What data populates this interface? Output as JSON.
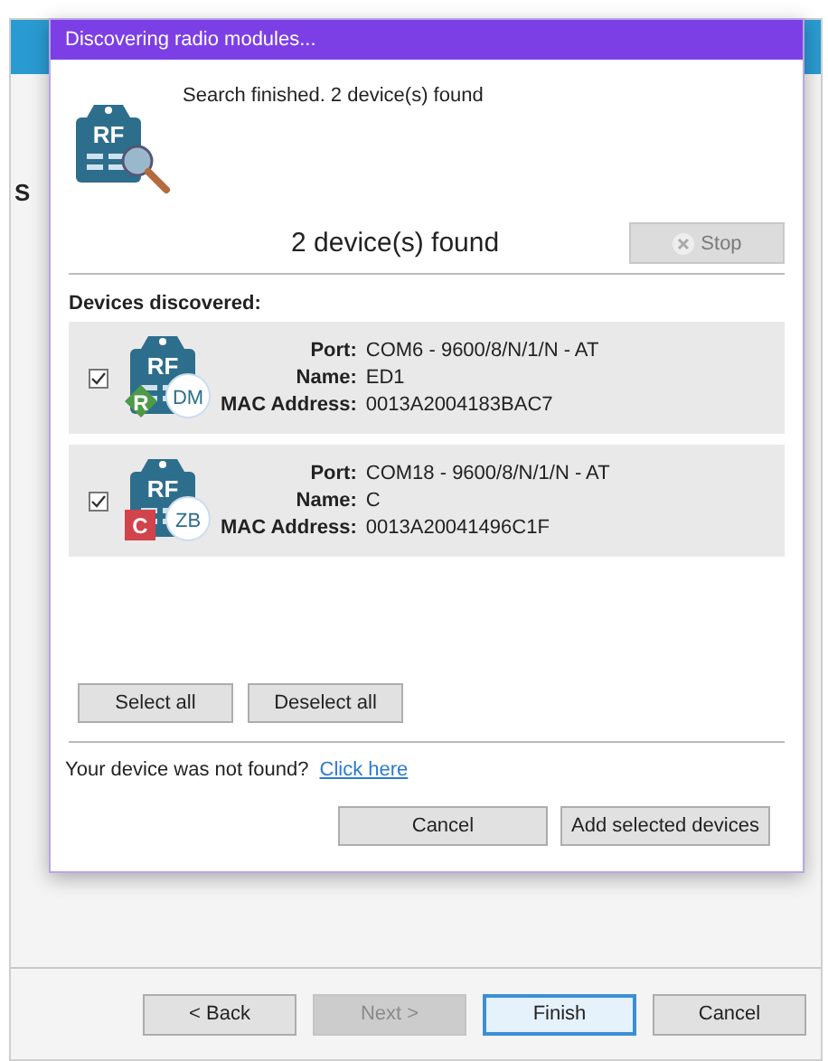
{
  "background_window": {
    "side_label": "S",
    "buttons": [
      {
        "label": "< Back",
        "disabled": false,
        "default": false
      },
      {
        "label": "Next >",
        "disabled": true,
        "default": false
      },
      {
        "label": "Finish",
        "disabled": false,
        "default": true
      },
      {
        "label": "Cancel",
        "disabled": false,
        "default": false
      }
    ]
  },
  "dialog": {
    "title": "Discovering radio modules...",
    "status_text": "Search finished. 2 device(s) found",
    "icon_label": "RF",
    "count_text": "2 device(s) found",
    "stop_button": {
      "label": "Stop",
      "disabled": true
    },
    "section_label": "Devices discovered:",
    "devices": [
      {
        "checked": true,
        "icon_label": "RF",
        "module": "DM",
        "badge": {
          "kind": "diamond",
          "letter": "R",
          "color": "#4e9a47"
        },
        "fields": [
          {
            "label": "Port:",
            "value": "COM6 - 9600/8/N/1/N - AT"
          },
          {
            "label": "Name:",
            "value": "ED1"
          },
          {
            "label": "MAC Address:",
            "value": "0013A2004183BAC7"
          }
        ]
      },
      {
        "checked": true,
        "icon_label": "RF",
        "module": "ZB",
        "badge": {
          "kind": "square",
          "letter": "C",
          "color": "#d2434b"
        },
        "fields": [
          {
            "label": "Port:",
            "value": "COM18 - 9600/8/N/1/N - AT"
          },
          {
            "label": "Name:",
            "value": "C"
          },
          {
            "label": "MAC Address:",
            "value": "0013A20041496C1F"
          }
        ]
      }
    ],
    "select_buttons": [
      "Select all",
      "Deselect all"
    ],
    "not_found_text": "Your device was not found?",
    "not_found_link": "Click here",
    "buttons": [
      "Cancel",
      "Add selected devices"
    ]
  }
}
